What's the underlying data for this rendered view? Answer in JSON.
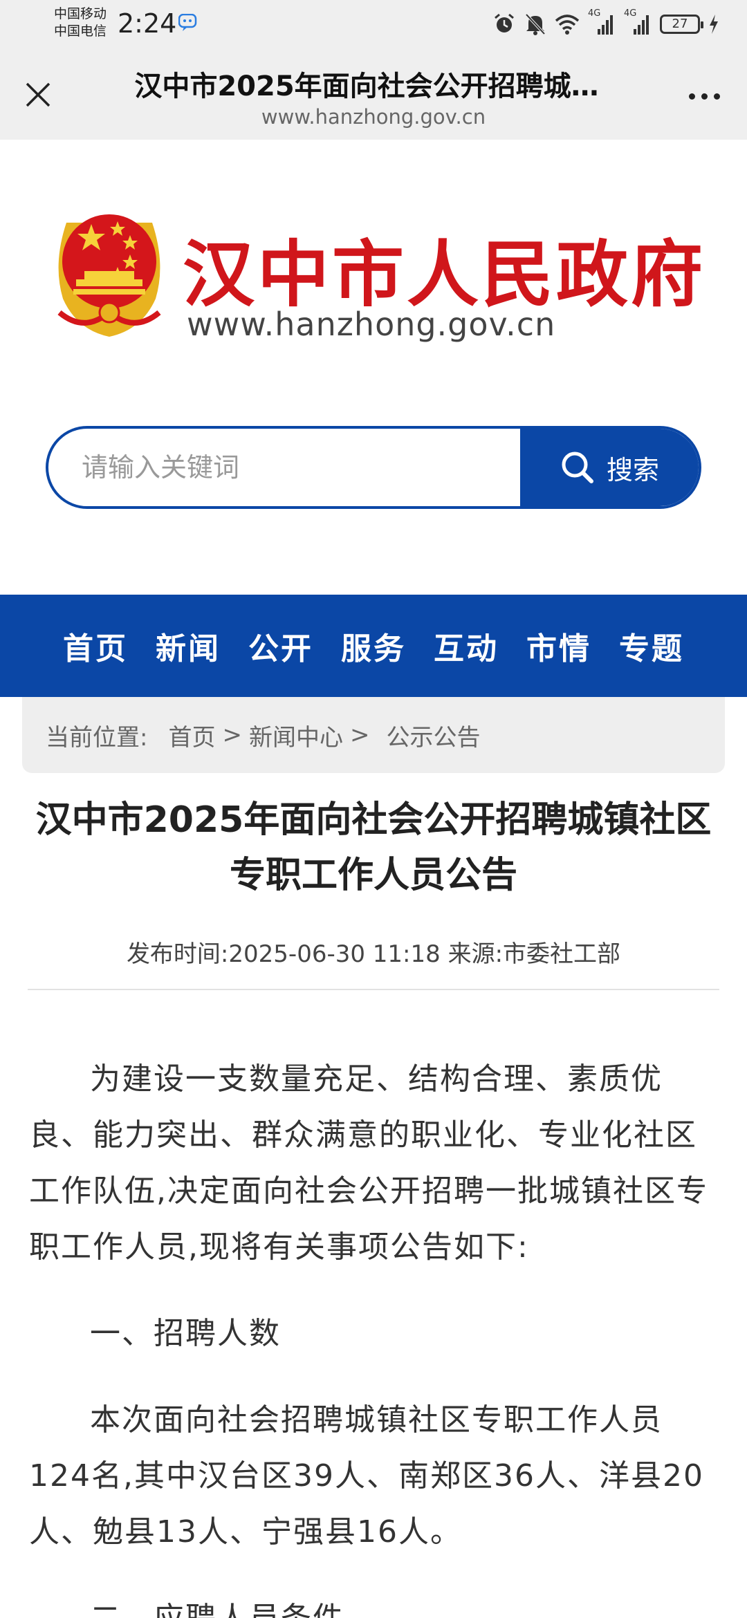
{
  "status_bar": {
    "carrier_1": "中国移动",
    "carrier_2": "中国电信",
    "time": "2:24",
    "network_1": "4G",
    "network_2": "4G",
    "battery": "27"
  },
  "browser": {
    "title": "汉中市2025年面向社会公开招聘城…",
    "url": "www.hanzhong.gov.cn"
  },
  "site": {
    "name": "汉中市人民政府",
    "domain": "www.hanzhong.gov.cn",
    "brand_red": "#d0161b",
    "brand_blue": "#0b47a6"
  },
  "search": {
    "placeholder": "请输入关键词",
    "button_label": "搜索"
  },
  "nav": {
    "items": [
      "首页",
      "新闻",
      "公开",
      "服务",
      "互动",
      "市情",
      "专题"
    ]
  },
  "breadcrumb": {
    "label": "当前位置:",
    "items": [
      "首页",
      "新闻中心",
      "公示公告"
    ],
    "separator": ">"
  },
  "article": {
    "title": "汉中市2025年面向社会公开招聘城镇社区专职工作人员公告",
    "meta": "发布时间:2025-06-30 11:18 来源:市委社工部",
    "paragraphs": [
      "为建设一支数量充足、结构合理、素质优良、能力突出、群众满意的职业化、专业化社区工作队伍,决定面向社会公开招聘一批城镇社区专职工作人员,现将有关事项公告如下:",
      "一、招聘人数",
      "本次面向社会招聘城镇社区专职工作人员124名,其中汉台区39人、南郑区36人、洋县20人、勉县13人、宁强县16人。",
      "二、应聘人员条件"
    ]
  }
}
